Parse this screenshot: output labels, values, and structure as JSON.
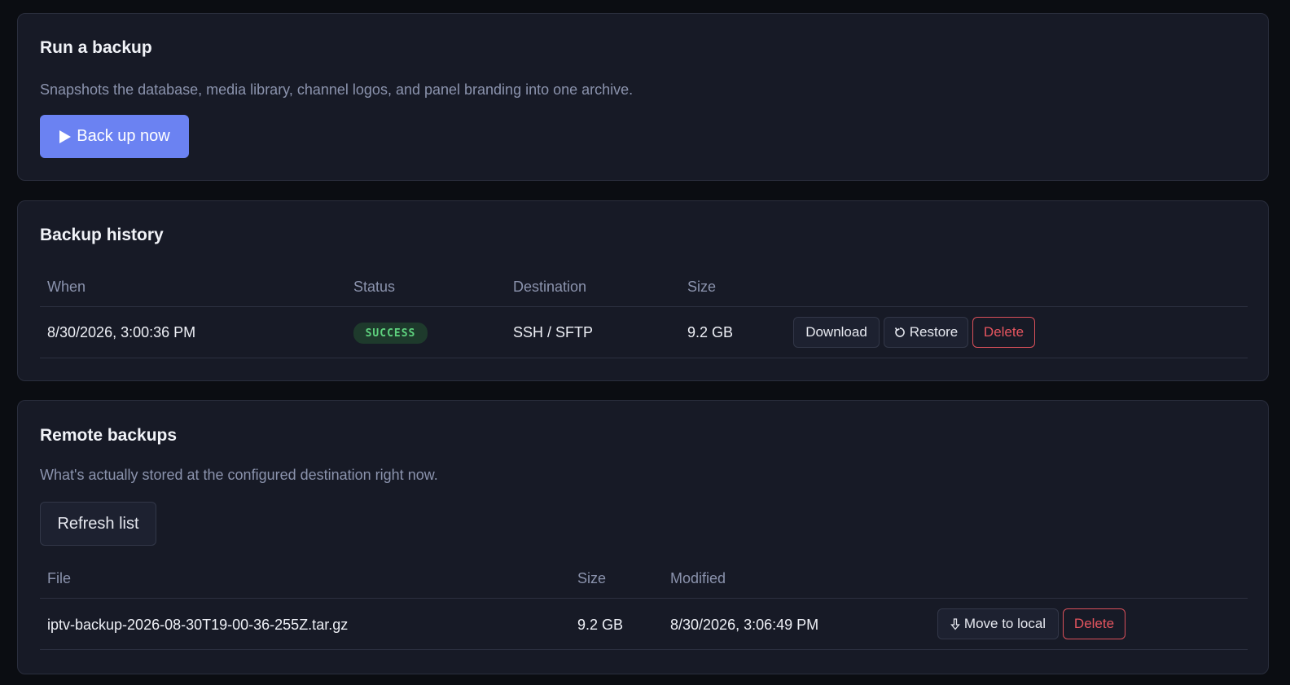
{
  "run_backup": {
    "title": "Run a backup",
    "description": "Snapshots the database, media library, channel logos, and panel branding into one archive.",
    "button_label": "Back up now",
    "button_icon": "play-icon"
  },
  "history": {
    "title": "Backup history",
    "columns": [
      "When",
      "Status",
      "Destination",
      "Size"
    ],
    "rows": [
      {
        "when": "8/30/2026, 3:00:36 PM",
        "status": "SUCCESS",
        "destination": "SSH / SFTP",
        "size": "9.2 GB",
        "download_label": "Download",
        "restore_label": "Restore",
        "delete_label": "Delete"
      }
    ]
  },
  "remote": {
    "title": "Remote backups",
    "description": "What's actually stored at the configured destination right now.",
    "refresh_label": "Refresh list",
    "columns": [
      "File",
      "Size",
      "Modified"
    ],
    "rows": [
      {
        "file": "iptv-backup-2026-08-30T19-00-36-255Z.tar.gz",
        "size": "9.2 GB",
        "modified": "8/30/2026, 3:06:49 PM",
        "move_label": "Move to local",
        "delete_label": "Delete"
      }
    ]
  },
  "colors": {
    "background": "#0b0d12",
    "card": "#171a26",
    "accent": "#6b82f2",
    "success": "#5fd37f",
    "danger": "#e5555f"
  }
}
